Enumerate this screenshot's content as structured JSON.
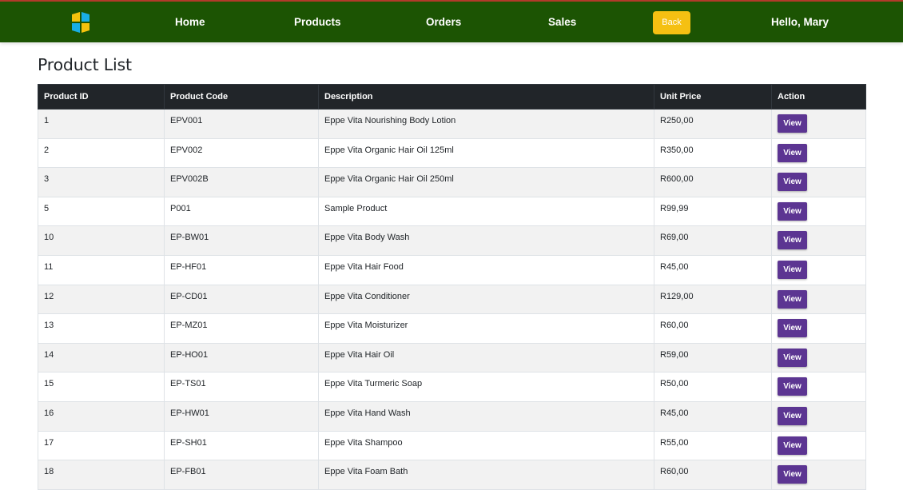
{
  "nav": {
    "home": "Home",
    "products": "Products",
    "orders": "Orders",
    "sales": "Sales",
    "back": "Back",
    "greeting": "Hello, Mary"
  },
  "page": {
    "title": "Product List"
  },
  "table": {
    "headers": [
      "Product ID",
      "Product Code",
      "Description",
      "Unit Price",
      "Action"
    ],
    "rows": [
      {
        "id": "1",
        "code": "EPV001",
        "description": "Eppe Vita Nourishing Body Lotion",
        "price": "R250,00",
        "action": "View"
      },
      {
        "id": "2",
        "code": "EPV002",
        "description": "Eppe Vita Organic Hair Oil 125ml",
        "price": "R350,00",
        "action": "View"
      },
      {
        "id": "3",
        "code": "EPV002B",
        "description": "Eppe Vita Organic Hair Oil 250ml",
        "price": "R600,00",
        "action": "View"
      },
      {
        "id": "5",
        "code": "P001",
        "description": "Sample Product",
        "price": "R99,99",
        "action": "View"
      },
      {
        "id": "10",
        "code": "EP-BW01",
        "description": "Eppe Vita Body Wash",
        "price": "R69,00",
        "action": "View"
      },
      {
        "id": "11",
        "code": "EP-HF01",
        "description": "Eppe Vita Hair Food",
        "price": "R45,00",
        "action": "View"
      },
      {
        "id": "12",
        "code": "EP-CD01",
        "description": "Eppe Vita Conditioner",
        "price": "R129,00",
        "action": "View"
      },
      {
        "id": "13",
        "code": "EP-MZ01",
        "description": "Eppe Vita Moisturizer",
        "price": "R60,00",
        "action": "View"
      },
      {
        "id": "14",
        "code": "EP-HO01",
        "description": "Eppe Vita Hair Oil",
        "price": "R59,00",
        "action": "View"
      },
      {
        "id": "15",
        "code": "EP-TS01",
        "description": "Eppe Vita Turmeric Soap",
        "price": "R50,00",
        "action": "View"
      },
      {
        "id": "16",
        "code": "EP-HW01",
        "description": "Eppe Vita Hand Wash",
        "price": "R45,00",
        "action": "View"
      },
      {
        "id": "17",
        "code": "EP-SH01",
        "description": "Eppe Vita Shampoo",
        "price": "R55,00",
        "action": "View"
      },
      {
        "id": "18",
        "code": "EP-FB01",
        "description": "Eppe Vita Foam Bath",
        "price": "R60,00",
        "action": "View"
      }
    ]
  },
  "colors": {
    "navbar": "#1c5403",
    "back_button": "#f5c012",
    "view_button": "#5c3592",
    "table_header": "#212529"
  },
  "icons": {
    "logo": "windows-logo-icon"
  }
}
